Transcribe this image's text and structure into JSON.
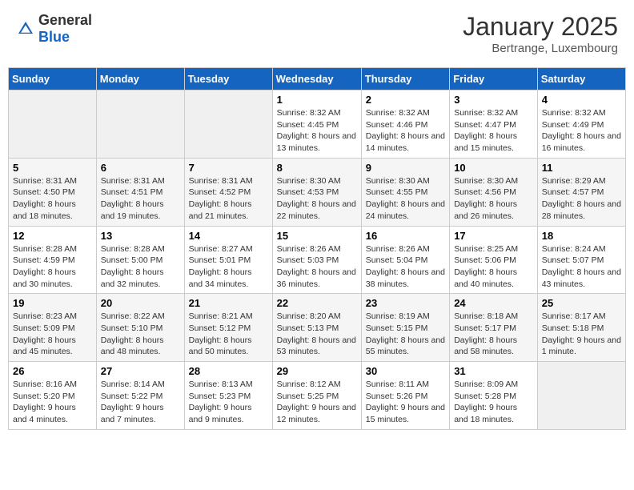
{
  "header": {
    "logo_general": "General",
    "logo_blue": "Blue",
    "month_title": "January 2025",
    "location": "Bertrange, Luxembourg"
  },
  "weekdays": [
    "Sunday",
    "Monday",
    "Tuesday",
    "Wednesday",
    "Thursday",
    "Friday",
    "Saturday"
  ],
  "weeks": [
    [
      {
        "day": "",
        "sunrise": "",
        "sunset": "",
        "daylight": ""
      },
      {
        "day": "",
        "sunrise": "",
        "sunset": "",
        "daylight": ""
      },
      {
        "day": "",
        "sunrise": "",
        "sunset": "",
        "daylight": ""
      },
      {
        "day": "1",
        "sunrise": "Sunrise: 8:32 AM",
        "sunset": "Sunset: 4:45 PM",
        "daylight": "Daylight: 8 hours and 13 minutes."
      },
      {
        "day": "2",
        "sunrise": "Sunrise: 8:32 AM",
        "sunset": "Sunset: 4:46 PM",
        "daylight": "Daylight: 8 hours and 14 minutes."
      },
      {
        "day": "3",
        "sunrise": "Sunrise: 8:32 AM",
        "sunset": "Sunset: 4:47 PM",
        "daylight": "Daylight: 8 hours and 15 minutes."
      },
      {
        "day": "4",
        "sunrise": "Sunrise: 8:32 AM",
        "sunset": "Sunset: 4:49 PM",
        "daylight": "Daylight: 8 hours and 16 minutes."
      }
    ],
    [
      {
        "day": "5",
        "sunrise": "Sunrise: 8:31 AM",
        "sunset": "Sunset: 4:50 PM",
        "daylight": "Daylight: 8 hours and 18 minutes."
      },
      {
        "day": "6",
        "sunrise": "Sunrise: 8:31 AM",
        "sunset": "Sunset: 4:51 PM",
        "daylight": "Daylight: 8 hours and 19 minutes."
      },
      {
        "day": "7",
        "sunrise": "Sunrise: 8:31 AM",
        "sunset": "Sunset: 4:52 PM",
        "daylight": "Daylight: 8 hours and 21 minutes."
      },
      {
        "day": "8",
        "sunrise": "Sunrise: 8:30 AM",
        "sunset": "Sunset: 4:53 PM",
        "daylight": "Daylight: 8 hours and 22 minutes."
      },
      {
        "day": "9",
        "sunrise": "Sunrise: 8:30 AM",
        "sunset": "Sunset: 4:55 PM",
        "daylight": "Daylight: 8 hours and 24 minutes."
      },
      {
        "day": "10",
        "sunrise": "Sunrise: 8:30 AM",
        "sunset": "Sunset: 4:56 PM",
        "daylight": "Daylight: 8 hours and 26 minutes."
      },
      {
        "day": "11",
        "sunrise": "Sunrise: 8:29 AM",
        "sunset": "Sunset: 4:57 PM",
        "daylight": "Daylight: 8 hours and 28 minutes."
      }
    ],
    [
      {
        "day": "12",
        "sunrise": "Sunrise: 8:28 AM",
        "sunset": "Sunset: 4:59 PM",
        "daylight": "Daylight: 8 hours and 30 minutes."
      },
      {
        "day": "13",
        "sunrise": "Sunrise: 8:28 AM",
        "sunset": "Sunset: 5:00 PM",
        "daylight": "Daylight: 8 hours and 32 minutes."
      },
      {
        "day": "14",
        "sunrise": "Sunrise: 8:27 AM",
        "sunset": "Sunset: 5:01 PM",
        "daylight": "Daylight: 8 hours and 34 minutes."
      },
      {
        "day": "15",
        "sunrise": "Sunrise: 8:26 AM",
        "sunset": "Sunset: 5:03 PM",
        "daylight": "Daylight: 8 hours and 36 minutes."
      },
      {
        "day": "16",
        "sunrise": "Sunrise: 8:26 AM",
        "sunset": "Sunset: 5:04 PM",
        "daylight": "Daylight: 8 hours and 38 minutes."
      },
      {
        "day": "17",
        "sunrise": "Sunrise: 8:25 AM",
        "sunset": "Sunset: 5:06 PM",
        "daylight": "Daylight: 8 hours and 40 minutes."
      },
      {
        "day": "18",
        "sunrise": "Sunrise: 8:24 AM",
        "sunset": "Sunset: 5:07 PM",
        "daylight": "Daylight: 8 hours and 43 minutes."
      }
    ],
    [
      {
        "day": "19",
        "sunrise": "Sunrise: 8:23 AM",
        "sunset": "Sunset: 5:09 PM",
        "daylight": "Daylight: 8 hours and 45 minutes."
      },
      {
        "day": "20",
        "sunrise": "Sunrise: 8:22 AM",
        "sunset": "Sunset: 5:10 PM",
        "daylight": "Daylight: 8 hours and 48 minutes."
      },
      {
        "day": "21",
        "sunrise": "Sunrise: 8:21 AM",
        "sunset": "Sunset: 5:12 PM",
        "daylight": "Daylight: 8 hours and 50 minutes."
      },
      {
        "day": "22",
        "sunrise": "Sunrise: 8:20 AM",
        "sunset": "Sunset: 5:13 PM",
        "daylight": "Daylight: 8 hours and 53 minutes."
      },
      {
        "day": "23",
        "sunrise": "Sunrise: 8:19 AM",
        "sunset": "Sunset: 5:15 PM",
        "daylight": "Daylight: 8 hours and 55 minutes."
      },
      {
        "day": "24",
        "sunrise": "Sunrise: 8:18 AM",
        "sunset": "Sunset: 5:17 PM",
        "daylight": "Daylight: 8 hours and 58 minutes."
      },
      {
        "day": "25",
        "sunrise": "Sunrise: 8:17 AM",
        "sunset": "Sunset: 5:18 PM",
        "daylight": "Daylight: 9 hours and 1 minute."
      }
    ],
    [
      {
        "day": "26",
        "sunrise": "Sunrise: 8:16 AM",
        "sunset": "Sunset: 5:20 PM",
        "daylight": "Daylight: 9 hours and 4 minutes."
      },
      {
        "day": "27",
        "sunrise": "Sunrise: 8:14 AM",
        "sunset": "Sunset: 5:22 PM",
        "daylight": "Daylight: 9 hours and 7 minutes."
      },
      {
        "day": "28",
        "sunrise": "Sunrise: 8:13 AM",
        "sunset": "Sunset: 5:23 PM",
        "daylight": "Daylight: 9 hours and 9 minutes."
      },
      {
        "day": "29",
        "sunrise": "Sunrise: 8:12 AM",
        "sunset": "Sunset: 5:25 PM",
        "daylight": "Daylight: 9 hours and 12 minutes."
      },
      {
        "day": "30",
        "sunrise": "Sunrise: 8:11 AM",
        "sunset": "Sunset: 5:26 PM",
        "daylight": "Daylight: 9 hours and 15 minutes."
      },
      {
        "day": "31",
        "sunrise": "Sunrise: 8:09 AM",
        "sunset": "Sunset: 5:28 PM",
        "daylight": "Daylight: 9 hours and 18 minutes."
      },
      {
        "day": "",
        "sunrise": "",
        "sunset": "",
        "daylight": ""
      }
    ]
  ]
}
